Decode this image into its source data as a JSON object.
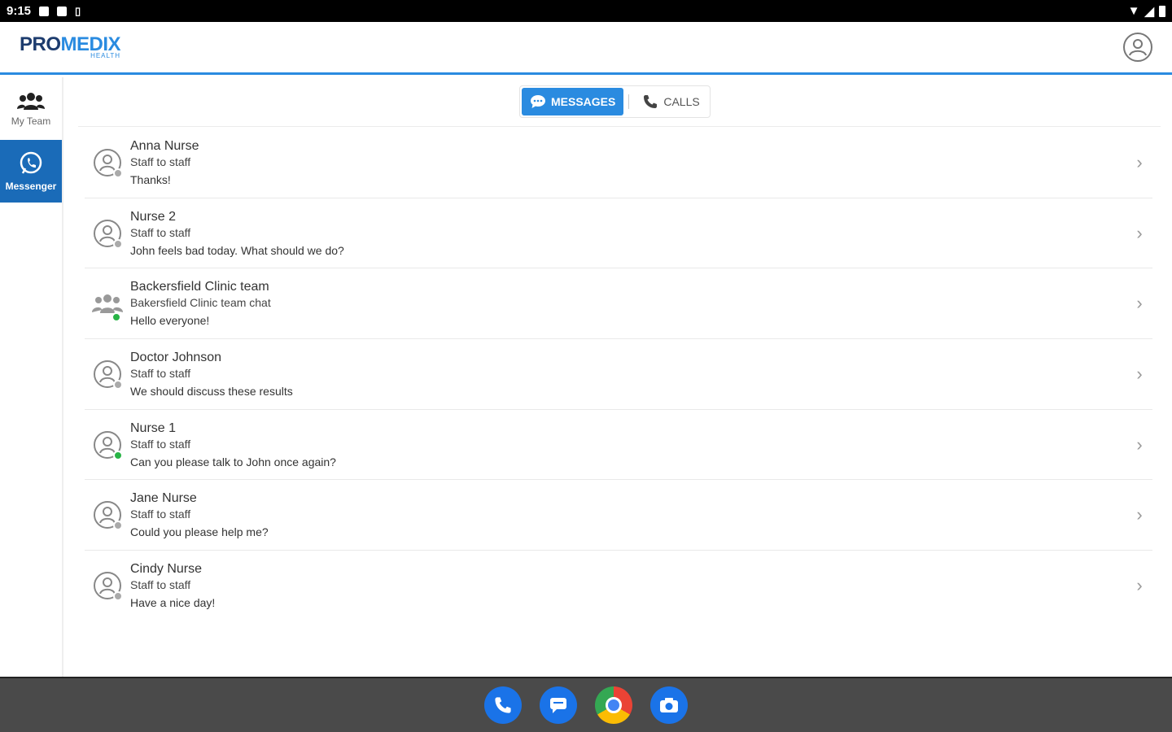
{
  "status_bar": {
    "time": "9:15"
  },
  "header": {
    "logo_main_a": "PRO",
    "logo_main_b": "MEDIX",
    "logo_sub": "HEALTH"
  },
  "sidebar": {
    "items": [
      {
        "label": "My Team",
        "icon": "group-icon"
      },
      {
        "label": "Messenger",
        "icon": "chat-phone-icon"
      }
    ]
  },
  "tabs": {
    "messages": "MESSAGES",
    "calls": "CALLS"
  },
  "conversations": [
    {
      "name": "Anna Nurse",
      "subtitle": "Staff to staff",
      "message": "Thanks!",
      "type": "person",
      "online": false
    },
    {
      "name": "Nurse 2",
      "subtitle": "Staff to staff",
      "message": "John feels bad today. What should we do?",
      "type": "person",
      "online": false
    },
    {
      "name": "Backersfield Clinic team",
      "subtitle": "Bakersfield Clinic team chat",
      "message": "Hello everyone!",
      "type": "group",
      "online": true
    },
    {
      "name": "Doctor Johnson",
      "subtitle": "Staff to staff",
      "message": "We should discuss these results",
      "type": "person",
      "online": false
    },
    {
      "name": "Nurse 1",
      "subtitle": "Staff to staff",
      "message": "Can you please talk to John once again?",
      "type": "person",
      "online": true
    },
    {
      "name": "Jane Nurse",
      "subtitle": "Staff to staff",
      "message": "Could you please help me?",
      "type": "person",
      "online": false
    },
    {
      "name": "Cindy Nurse",
      "subtitle": "Staff to staff",
      "message": "Have a nice day!",
      "type": "person",
      "online": false
    }
  ],
  "colors": {
    "accent": "#2a8be0",
    "sidebar_active": "#1a6bb8",
    "online": "#28b446"
  }
}
